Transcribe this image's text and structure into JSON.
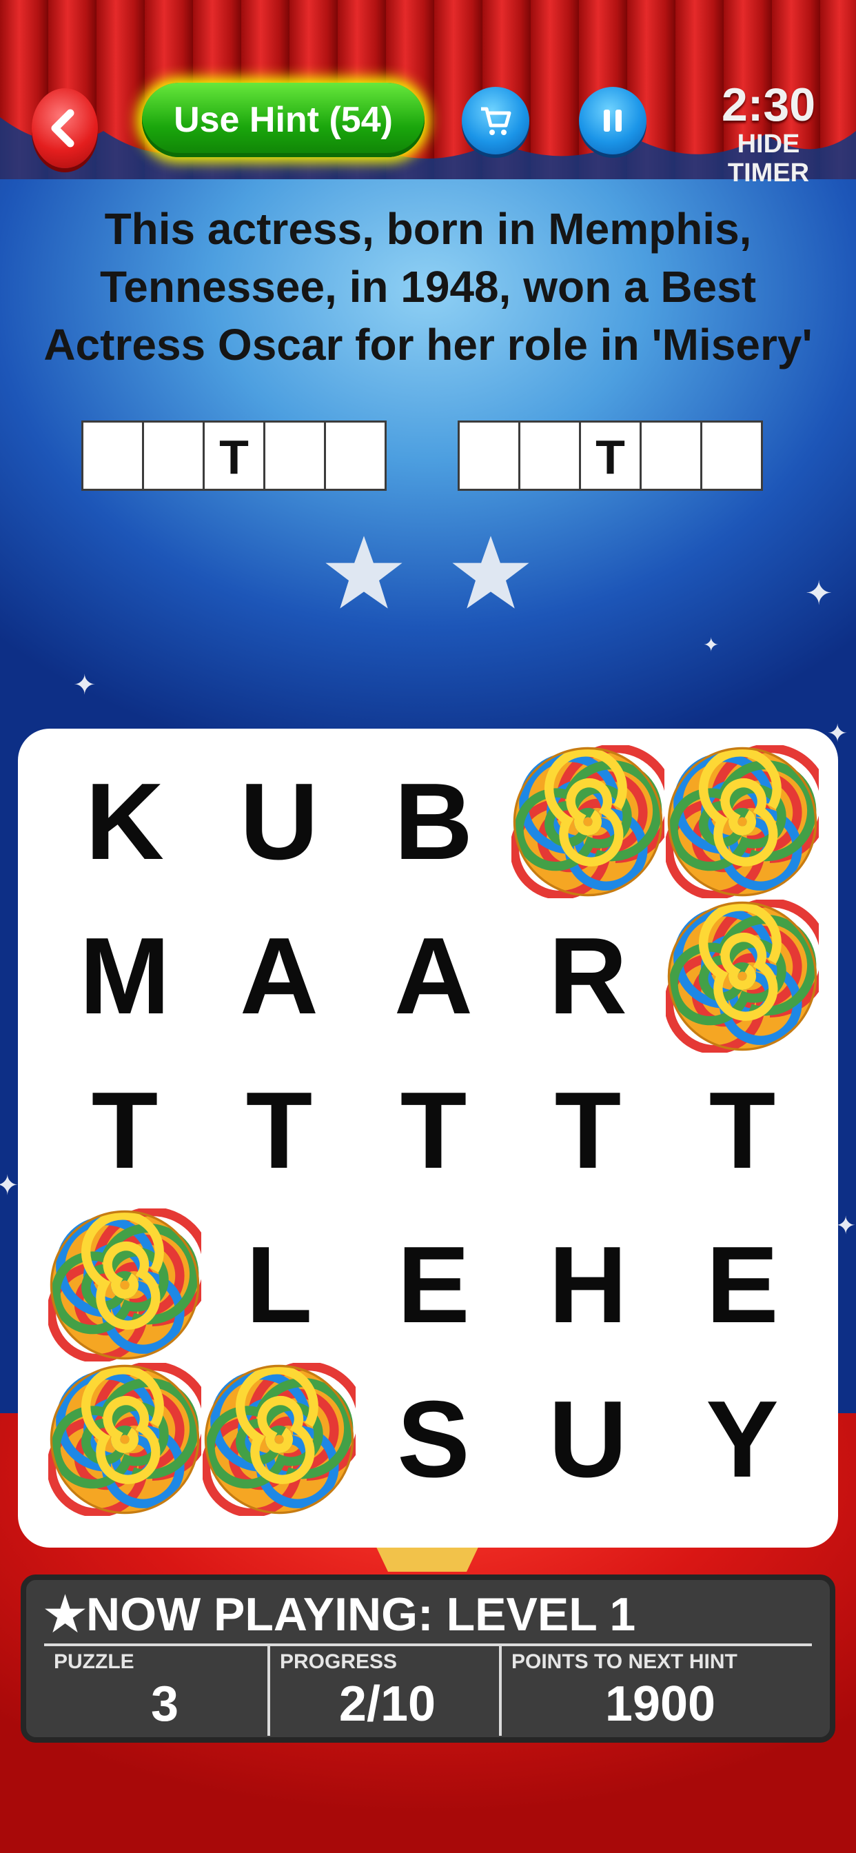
{
  "header": {
    "hint_button": "Use Hint (54)",
    "timer": "2:30",
    "timer_toggle": "HIDE TIMER"
  },
  "clue": {
    "text": "This actress, born in Memphis, Tennessee, in 1948, won a Best Actress Oscar for her role in 'Misery'"
  },
  "answer": {
    "words": [
      [
        "",
        "",
        "T",
        "",
        ""
      ],
      [
        "",
        "",
        "T",
        "",
        ""
      ]
    ],
    "stars_earned": 2
  },
  "board": {
    "rows": [
      [
        "K",
        "U",
        "B",
        "candy",
        "candy"
      ],
      [
        "M",
        "A",
        "A",
        "R",
        "candy"
      ],
      [
        "T",
        "T",
        "T",
        "T",
        "T"
      ],
      [
        "candy",
        "L",
        "E",
        "H",
        "E"
      ],
      [
        "candy",
        "candy",
        "S",
        "U",
        "Y"
      ]
    ]
  },
  "status": {
    "title": "NOW PLAYING: LEVEL 1",
    "puzzle_label": "PUZZLE",
    "puzzle_value": "3",
    "progress_label": "PROGRESS",
    "progress_value": "2/10",
    "points_label": "POINTS TO NEXT HINT",
    "points_value": "1900"
  },
  "colors": {
    "hint_green": "#1aa60c",
    "curtain_red": "#c81818",
    "stage_blue": "#1d56b8",
    "panel_gray": "#3d3d3d"
  }
}
